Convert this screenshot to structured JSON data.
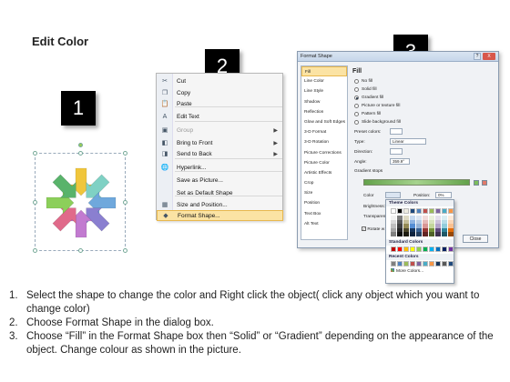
{
  "title": "Edit Color",
  "steps": [
    "1",
    "2",
    "3"
  ],
  "context_menu": {
    "items": [
      {
        "icon": "scissors-icon",
        "glyph": "✂",
        "label": "Cut",
        "disabled": false,
        "submenu": false
      },
      {
        "icon": "copy-icon",
        "glyph": "❐",
        "label": "Copy",
        "disabled": false,
        "submenu": false
      },
      {
        "icon": "paste-icon",
        "glyph": "📋",
        "label": "Paste",
        "disabled": false,
        "submenu": false
      },
      {
        "icon": "edit-text-icon",
        "glyph": "A",
        "label": "Edit Text",
        "disabled": false,
        "submenu": false
      },
      {
        "icon": "group-icon",
        "glyph": "▣",
        "label": "Group",
        "disabled": true,
        "submenu": true
      },
      {
        "icon": "bring-front-icon",
        "glyph": "◧",
        "label": "Bring to Front",
        "disabled": false,
        "submenu": true
      },
      {
        "icon": "send-back-icon",
        "glyph": "◨",
        "label": "Send to Back",
        "disabled": false,
        "submenu": true
      },
      {
        "icon": "hyperlink-icon",
        "glyph": "🌐",
        "label": "Hyperlink...",
        "disabled": false,
        "submenu": false
      },
      {
        "icon": "",
        "glyph": "",
        "label": "Save as Picture...",
        "disabled": false,
        "submenu": false
      },
      {
        "icon": "",
        "glyph": "",
        "label": "Set as Default Shape",
        "disabled": false,
        "submenu": false
      },
      {
        "icon": "size-position-icon",
        "glyph": "▦",
        "label": "Size and Position...",
        "disabled": false,
        "submenu": false
      },
      {
        "icon": "format-shape-icon",
        "glyph": "◆",
        "label": "Format Shape...",
        "disabled": false,
        "submenu": false
      }
    ]
  },
  "dialog": {
    "title": "Format Shape",
    "help": "?",
    "close_x": "X",
    "nav": [
      "Fill",
      "Line Color",
      "Line Style",
      "Shadow",
      "Reflection",
      "Glow and Soft Edges",
      "3-D Format",
      "3-D Rotation",
      "Picture Corrections",
      "Picture Color",
      "Artistic Effects",
      "Crop",
      "Size",
      "Position",
      "Text Box",
      "Alt Text"
    ],
    "fill_heading": "Fill",
    "options": [
      "No fill",
      "Solid fill",
      "Gradient fill",
      "Picture or texture fill",
      "Pattern fill",
      "Slide background fill"
    ],
    "selected_option": "Gradient fill",
    "preset_label": "Preset colors:",
    "type_label": "Type:",
    "type_value": "Linear",
    "direction_label": "Direction:",
    "angle_label": "Angle:",
    "angle_value": "359.9°",
    "gradient_stops_label": "Gradient stops",
    "color_label": "Color",
    "position_label": "Position:",
    "position_value": "0%",
    "brightness_label": "Brightness:",
    "transparency_label": "Transparency:",
    "rotate_label": "Rotate w",
    "close_button": "Close"
  },
  "color_picker": {
    "theme_heading": "Theme Colors",
    "standard_heading": "Standard Colors",
    "recent_heading": "Recent Colors",
    "more_colors": "More Colors...",
    "theme_top": [
      "#ffffff",
      "#000000",
      "#eeece1",
      "#1f497d",
      "#4f81bd",
      "#c0504d",
      "#9bbb59",
      "#8064a2",
      "#4bacc6",
      "#f79646"
    ],
    "theme_columns": [
      [
        "#f2f2f2",
        "#d9d9d9",
        "#bfbfbf",
        "#a6a6a6",
        "#808080"
      ],
      [
        "#7f7f7f",
        "#595959",
        "#404040",
        "#262626",
        "#0d0d0d"
      ],
      [
        "#ddd9c3",
        "#c4bd97",
        "#948a54",
        "#4a452a",
        "#1d1b10"
      ],
      [
        "#c6d9f0",
        "#8db3e2",
        "#548dd4",
        "#17365d",
        "#0f243e"
      ],
      [
        "#dbe5f1",
        "#b8cce4",
        "#95b3d7",
        "#366092",
        "#244061"
      ],
      [
        "#f2dcdb",
        "#e5b9b7",
        "#d99694",
        "#953734",
        "#632423"
      ],
      [
        "#ebf1dd",
        "#d7e3bc",
        "#c3d69b",
        "#76923c",
        "#4f6128"
      ],
      [
        "#e5e0ec",
        "#ccc1d9",
        "#b2a2c7",
        "#5f497a",
        "#3f3151"
      ],
      [
        "#dbeef3",
        "#b7dde8",
        "#92cddc",
        "#31859b",
        "#205867"
      ],
      [
        "#fdeada",
        "#fbd5b5",
        "#fac08f",
        "#e36c09",
        "#974806"
      ]
    ],
    "standard": [
      "#c00000",
      "#ff0000",
      "#ffc000",
      "#ffff00",
      "#92d050",
      "#00b050",
      "#00b0f0",
      "#0070c0",
      "#002060",
      "#7030a0"
    ],
    "recent": [
      "#7f7f7f",
      "#4f81bd",
      "#9bbb59",
      "#c0504d",
      "#8064a2",
      "#4bacc6",
      "#f79646",
      "#17365d",
      "#595959",
      "#1f497d"
    ]
  },
  "instructions": [
    {
      "num": "1.",
      "text": "Select the shape to change the color and Right click the object( click any object which you want to change color)"
    },
    {
      "num": "2.",
      "text": "Choose Format Shape in the dialog box."
    },
    {
      "num": "3.",
      "text": "Choose “Fill” in the Format Shape box then “Solid” or “Gradient” depending on the appearance of the object. Change colour as shown in the picture."
    }
  ],
  "arrow_colors": [
    "#f0c63c",
    "#7fd1c4",
    "#6fa8dc",
    "#8a7fd0",
    "#c27bd0",
    "#e06a8a",
    "#8ccf5a",
    "#59b36b"
  ]
}
